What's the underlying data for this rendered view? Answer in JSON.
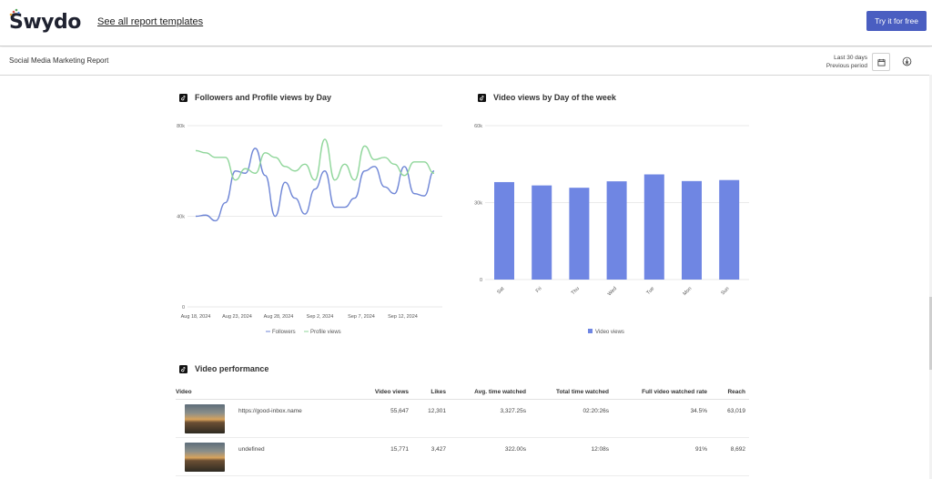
{
  "header": {
    "logo_text": "Swydo",
    "templates_link": "See all report templates",
    "cta_label": "Try it for free"
  },
  "subbar": {
    "report_title": "Social Media Marketing Report",
    "period_main": "Last 30 days",
    "period_compare": "Previous period",
    "calendar_icon": "calendar-icon",
    "download_icon": "download-icon"
  },
  "colors": {
    "accent": "#4a5ec1",
    "followers": "#6f86d6",
    "profile_views": "#8fd69a",
    "bar": "#6f86e3"
  },
  "followers_chart": {
    "title": "Followers and Profile views by Day",
    "icon": "tiktok-icon",
    "legend": [
      "Followers",
      "Profile views"
    ]
  },
  "weekday_chart": {
    "title": "Video views by Day of the week",
    "icon": "tiktok-icon",
    "legend": [
      "Video views"
    ]
  },
  "chart_data": [
    {
      "type": "line",
      "title": "Followers and Profile views by Day",
      "ylim": [
        0,
        80000
      ],
      "y_ticks": [
        "80k",
        "40k",
        "0"
      ],
      "x_ticks": [
        "Aug 18, 2024",
        "Aug 23, 2024",
        "Aug 28, 2024",
        "Sep 2, 2024",
        "Sep 7, 2024",
        "Sep 12, 2024"
      ],
      "series": [
        {
          "name": "Followers",
          "values": [
            40000,
            40500,
            38000,
            46000,
            60000,
            59000,
            70000,
            58000,
            40000,
            55000,
            48000,
            41000,
            52000,
            60000,
            44000,
            44000,
            48000,
            60000,
            62000,
            53000,
            50000,
            62000,
            50000,
            49000,
            60000
          ]
        },
        {
          "name": "Profile views",
          "values": [
            69000,
            68000,
            66000,
            66000,
            56000,
            61000,
            59000,
            68000,
            66000,
            62000,
            60000,
            63000,
            56000,
            74000,
            56000,
            63000,
            56000,
            71000,
            65000,
            66000,
            63000,
            58000,
            64000,
            64000,
            59000
          ]
        }
      ]
    },
    {
      "type": "bar",
      "title": "Video views by Day of the week",
      "ylim": [
        0,
        60000
      ],
      "y_ticks": [
        "60k",
        "30k",
        "0"
      ],
      "categories": [
        "Sat",
        "Fri",
        "Thu",
        "Wed",
        "Tue",
        "Mon",
        "Sun"
      ],
      "series": [
        {
          "name": "Video views",
          "values": [
            38000,
            36700,
            35800,
            38300,
            41000,
            38400,
            38800
          ]
        }
      ]
    }
  ],
  "video_performance": {
    "title": "Video performance",
    "icon": "tiktok-icon",
    "columns": [
      "Video",
      "Video views",
      "Likes",
      "Avg. time watched",
      "Total time watched",
      "Full video watched rate",
      "Reach"
    ],
    "rows": [
      {
        "name": "https://good-inbox.name",
        "views": "55,647",
        "likes": "12,301",
        "avg": "3,327.25s",
        "total": "02:20:26s",
        "rate": "34.5%",
        "reach": "63,019"
      },
      {
        "name": "undefined",
        "views": "15,771",
        "likes": "3,427",
        "avg": "322.00s",
        "total": "12:08s",
        "rate": "91%",
        "reach": "8,692"
      }
    ]
  }
}
